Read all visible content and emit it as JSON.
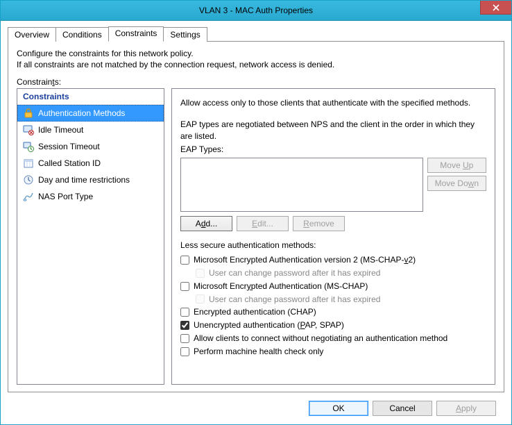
{
  "window": {
    "title": "VLAN 3 - MAC Auth Properties"
  },
  "tabs": {
    "overview": "Overview",
    "conditions": "Conditions",
    "constraints": "Constraints",
    "settings": "Settings"
  },
  "desc_line1": "Configure the constraints for this network policy.",
  "desc_line2": "If all constraints are not matched by the connection request, network access is denied.",
  "constraints_label": "Constraints:",
  "list": {
    "header": "Constraints",
    "items": [
      "Authentication Methods",
      "Idle Timeout",
      "Session Timeout",
      "Called Station ID",
      "Day and time restrictions",
      "NAS Port Type"
    ]
  },
  "right": {
    "intro": "Allow access only to those clients that authenticate with the specified methods.",
    "eap_intro": "EAP types are negotiated between NPS and the client in the order in which they are listed.",
    "eap_label": "EAP Types:",
    "move_up": "Move Up",
    "move_down": "Move Down",
    "add": "Add...",
    "edit": "Edit...",
    "remove": "Remove",
    "less_secure": "Less secure authentication methods:",
    "chk_mschapv2": "Microsoft Encrypted Authentication version 2 (MS-CHAP-v2)",
    "chk_pw_expire1": "User can change password after it has expired",
    "chk_mschap": "Microsoft Encrypted Authentication (MS-CHAP)",
    "chk_pw_expire2": "User can change password after it has expired",
    "chk_chap": "Encrypted authentication (CHAP)",
    "chk_pap": "Unencrypted authentication (PAP, SPAP)",
    "chk_noauth": "Allow clients to connect without negotiating an authentication method",
    "chk_health": "Perform machine health check only"
  },
  "footer": {
    "ok": "OK",
    "cancel": "Cancel",
    "apply": "Apply"
  }
}
